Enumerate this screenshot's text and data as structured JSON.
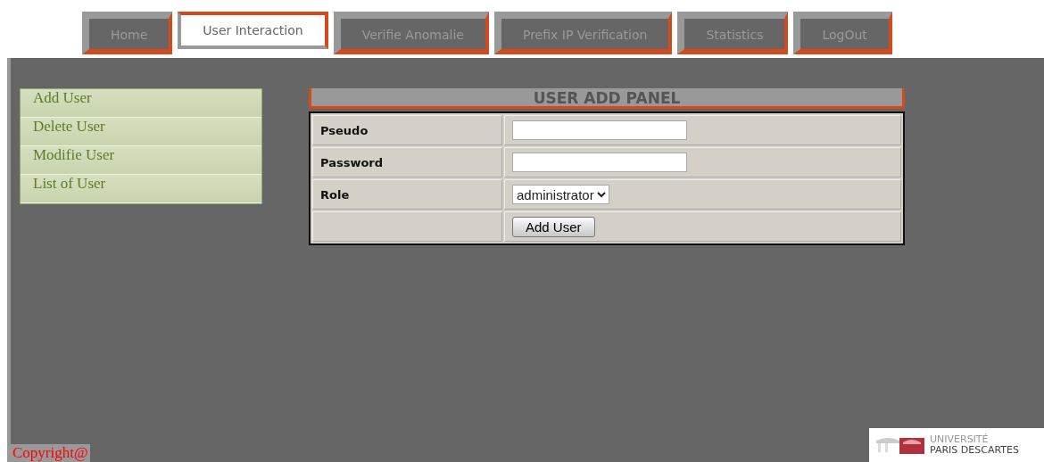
{
  "tabs": [
    {
      "label": "Home",
      "selected": false
    },
    {
      "label": "User Interaction",
      "selected": true
    },
    {
      "label": "Verifie Anomalie",
      "selected": false
    },
    {
      "label": "Prefix IP Verification",
      "selected": false
    },
    {
      "label": "Statistics",
      "selected": false
    },
    {
      "label": "LogOut",
      "selected": false
    }
  ],
  "sidebar": {
    "items": [
      "Add User",
      "Delete User",
      "Modifie User",
      "List of User"
    ]
  },
  "panel": {
    "title": "USER ADD PANEL",
    "fields": [
      {
        "label": "Pseudo",
        "kind": "text"
      },
      {
        "label": "Password",
        "kind": "password"
      },
      {
        "label": "Role",
        "kind": "select",
        "value": "administrator"
      }
    ],
    "button": "Add User"
  },
  "footer": {
    "copyright": "Copyright@",
    "logo": {
      "line_1": "UNIVERSITÉ",
      "line_2": "PARIS DESCARTES"
    }
  }
}
